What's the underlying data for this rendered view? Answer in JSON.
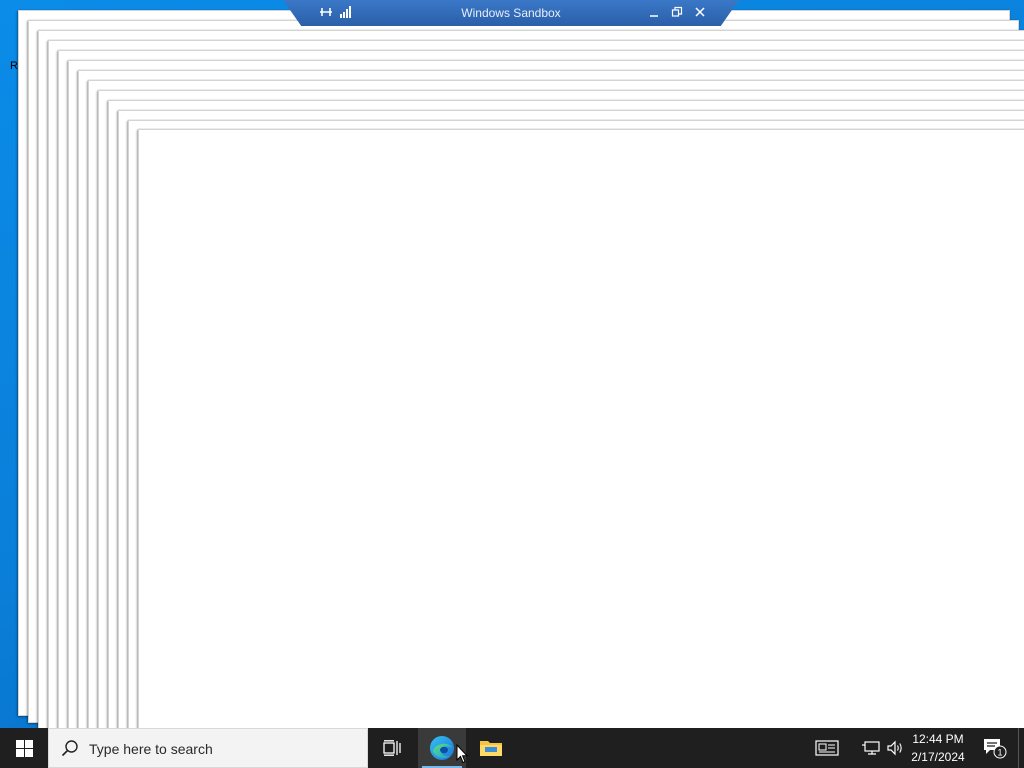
{
  "desktop": {
    "partial_icon_letter": "R"
  },
  "sandbox_bar": {
    "title": "Windows Sandbox",
    "pin_icon": "pin-icon",
    "signal_icon": "signal-icon",
    "minimize_icon": "minimize-icon",
    "restore_icon": "restore-icon",
    "close_icon": "close-icon"
  },
  "taskbar": {
    "search_placeholder": "Type here to search",
    "apps": [
      {
        "name": "Task View",
        "icon": "task-view-icon"
      },
      {
        "name": "Microsoft Edge",
        "icon": "edge-icon",
        "active": true
      },
      {
        "name": "File Explorer",
        "icon": "folder-icon"
      }
    ],
    "tray": {
      "time": "12:44 PM",
      "date": "2/17/2024",
      "notification_count": "1"
    },
    "colors": {
      "taskbar_bg": "#1f1f1f",
      "accent": "#76b9ed"
    }
  }
}
